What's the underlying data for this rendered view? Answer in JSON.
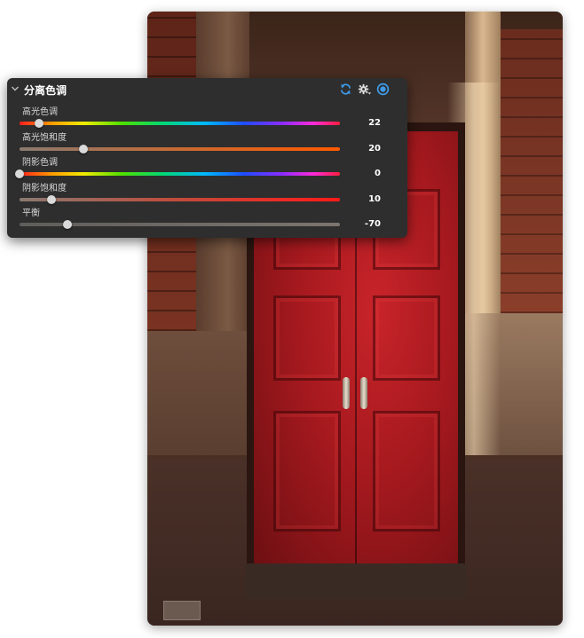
{
  "panel": {
    "title": "分离色调",
    "header_icons": [
      "reset-icon",
      "settings-gear-icon",
      "enable-toggle-icon"
    ],
    "accent_color": "#2f8ee0"
  },
  "sliders": [
    {
      "label": "高光色调",
      "value": "22",
      "position": 0.06,
      "track": "hue"
    },
    {
      "label": "高光饱和度",
      "value": "20",
      "position": 0.2,
      "track": "sat-highlight"
    },
    {
      "label": "阴影色调",
      "value": "0",
      "position": 0.0,
      "track": "hue"
    },
    {
      "label": "阴影饱和度",
      "value": "10",
      "position": 0.1,
      "track": "sat-shadow"
    },
    {
      "label": "平衡",
      "value": "-70",
      "position": 0.15,
      "track": "balance"
    }
  ]
}
